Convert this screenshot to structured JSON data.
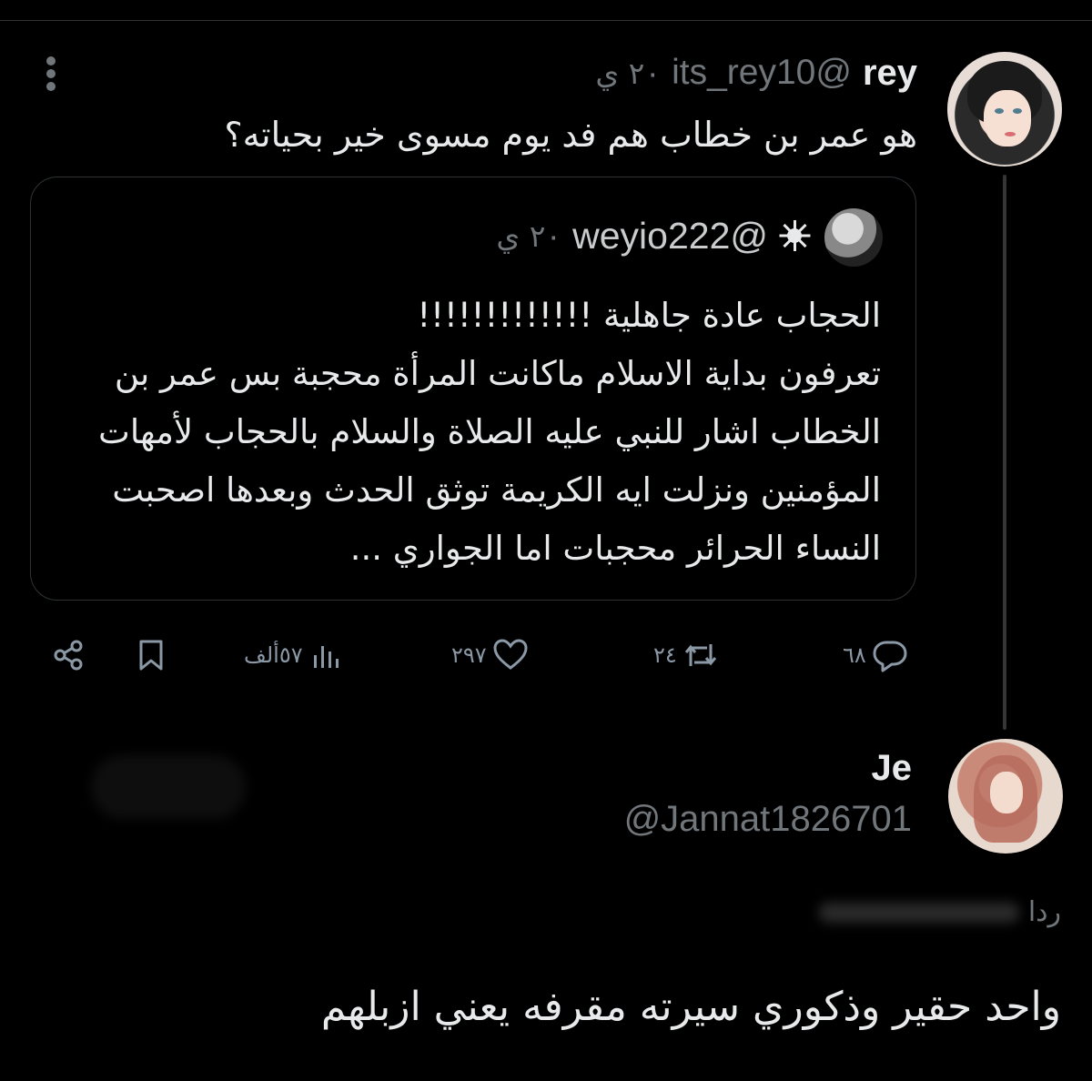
{
  "tweet1": {
    "name": "rey",
    "handle": "@its_rey10",
    "time": "٢٠ ي",
    "text": "هو عمر بن خطاب هم فد يوم مسوى خير بحياته؟"
  },
  "quote": {
    "handle": "@weyio222",
    "time": "٢٠ ي",
    "text": "الحجاب عادة جاهلية !!!!!!!!!!!!!\nتعرفون بداية الاسلام ماكانت المرأة محجبة بس عمر بن الخطاب اشار للنبي عليه الصلاة والسلام بالحجاب لأمهات المؤمنين ونزلت ايه الكريمة توثق الحدث وبعدها اصحبت النساء الحرائر محجبات اما الجواري ..."
  },
  "actions": {
    "replies": "٦٨",
    "retweets": "٢٤",
    "likes": "٢٩٧",
    "views": "٥٧ألف"
  },
  "tweet2": {
    "name": "Je",
    "handle": "@Jannat1826701",
    "reply_to": "ردا",
    "text": "واحد حقير وذكوري سيرته مقرفه يعني ازبلهم"
  },
  "colors": {
    "background": "#000000",
    "text": "#e7e9ea",
    "muted": "#71767b",
    "border": "#2f3336"
  }
}
